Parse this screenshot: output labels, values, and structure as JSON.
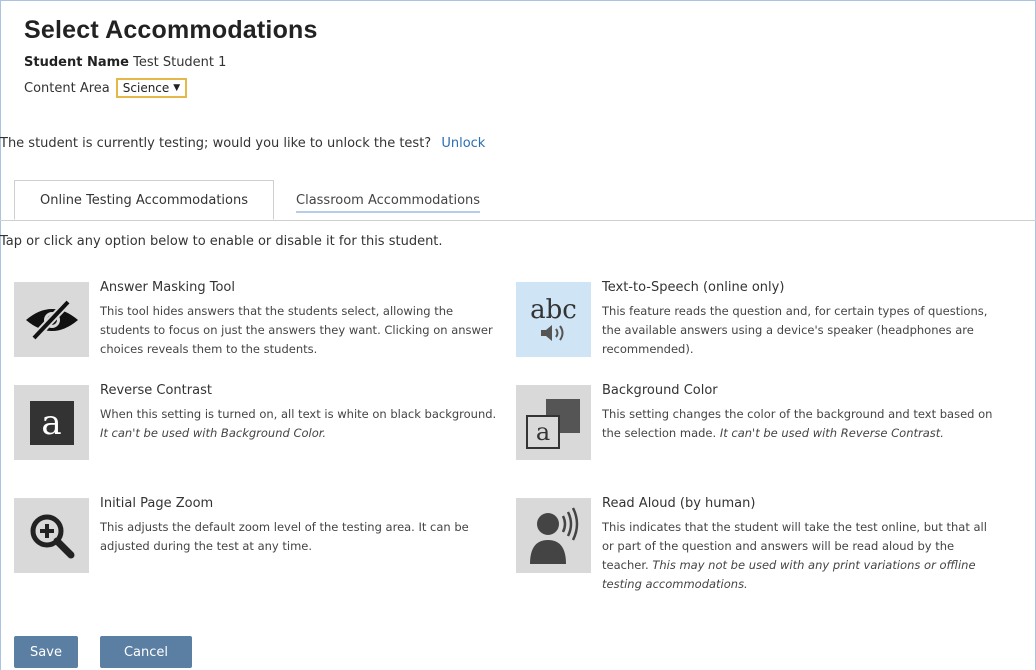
{
  "page": {
    "title": "Select Accommodations"
  },
  "student": {
    "label": "Student Name",
    "value": "Test Student 1"
  },
  "content_area": {
    "label": "Content Area",
    "selected": "Science"
  },
  "unlock": {
    "message": "The student is currently testing; would you like to unlock the test?",
    "link": "Unlock"
  },
  "tabs": [
    {
      "label": "Online Testing Accommodations",
      "active": true
    },
    {
      "label": "Classroom Accommodations",
      "active": false
    }
  ],
  "instruction": "Tap or click any option below to enable or disable it for this student.",
  "accommodations": [
    {
      "name": "Answer Masking Tool",
      "desc": "This tool hides answers that the students select, allowing the students to focus on just the answers they want. Clicking on answer choices reveals them to the students.",
      "note": "",
      "icon": "eye-slash-icon"
    },
    {
      "name": "Text-to-Speech (online only)",
      "desc": "This feature reads the question and, for certain types of questions, the available answers using a device's speaker (headphones are recommended).",
      "note": "",
      "icon": "text-to-speech-icon",
      "icon_text": "abc"
    },
    {
      "name": "Reverse Contrast",
      "desc": "When this setting is turned on, all text is white on black background.",
      "note": "It can't be used with Background Color.",
      "icon": "reverse-contrast-icon",
      "icon_text": "a"
    },
    {
      "name": "Background Color",
      "desc": "This setting changes the color of the background and text based on the selection made.",
      "note": "It can't be used with Reverse Contrast.",
      "icon": "background-color-icon",
      "icon_text": "a"
    },
    {
      "name": "Initial Page Zoom",
      "desc": "This adjusts the default zoom level of the testing area. It can be adjusted during the test at any time.",
      "note": "",
      "icon": "zoom-in-icon"
    },
    {
      "name": "Read Aloud (by human)",
      "desc": "This indicates that the student will take the test online, but that all or part of the question and answers will be read aloud by the teacher.",
      "note": "This may not be used with any print variations or offline testing accommodations.",
      "icon": "read-aloud-icon"
    }
  ],
  "buttons": {
    "save": "Save",
    "cancel": "Cancel"
  },
  "colors": {
    "link": "#2a6db3",
    "button": "#5b7ea3",
    "select_border": "#e6b84a",
    "icon_bg": "#d9d9d9",
    "icon_bg_blue": "#cfe4f4"
  }
}
